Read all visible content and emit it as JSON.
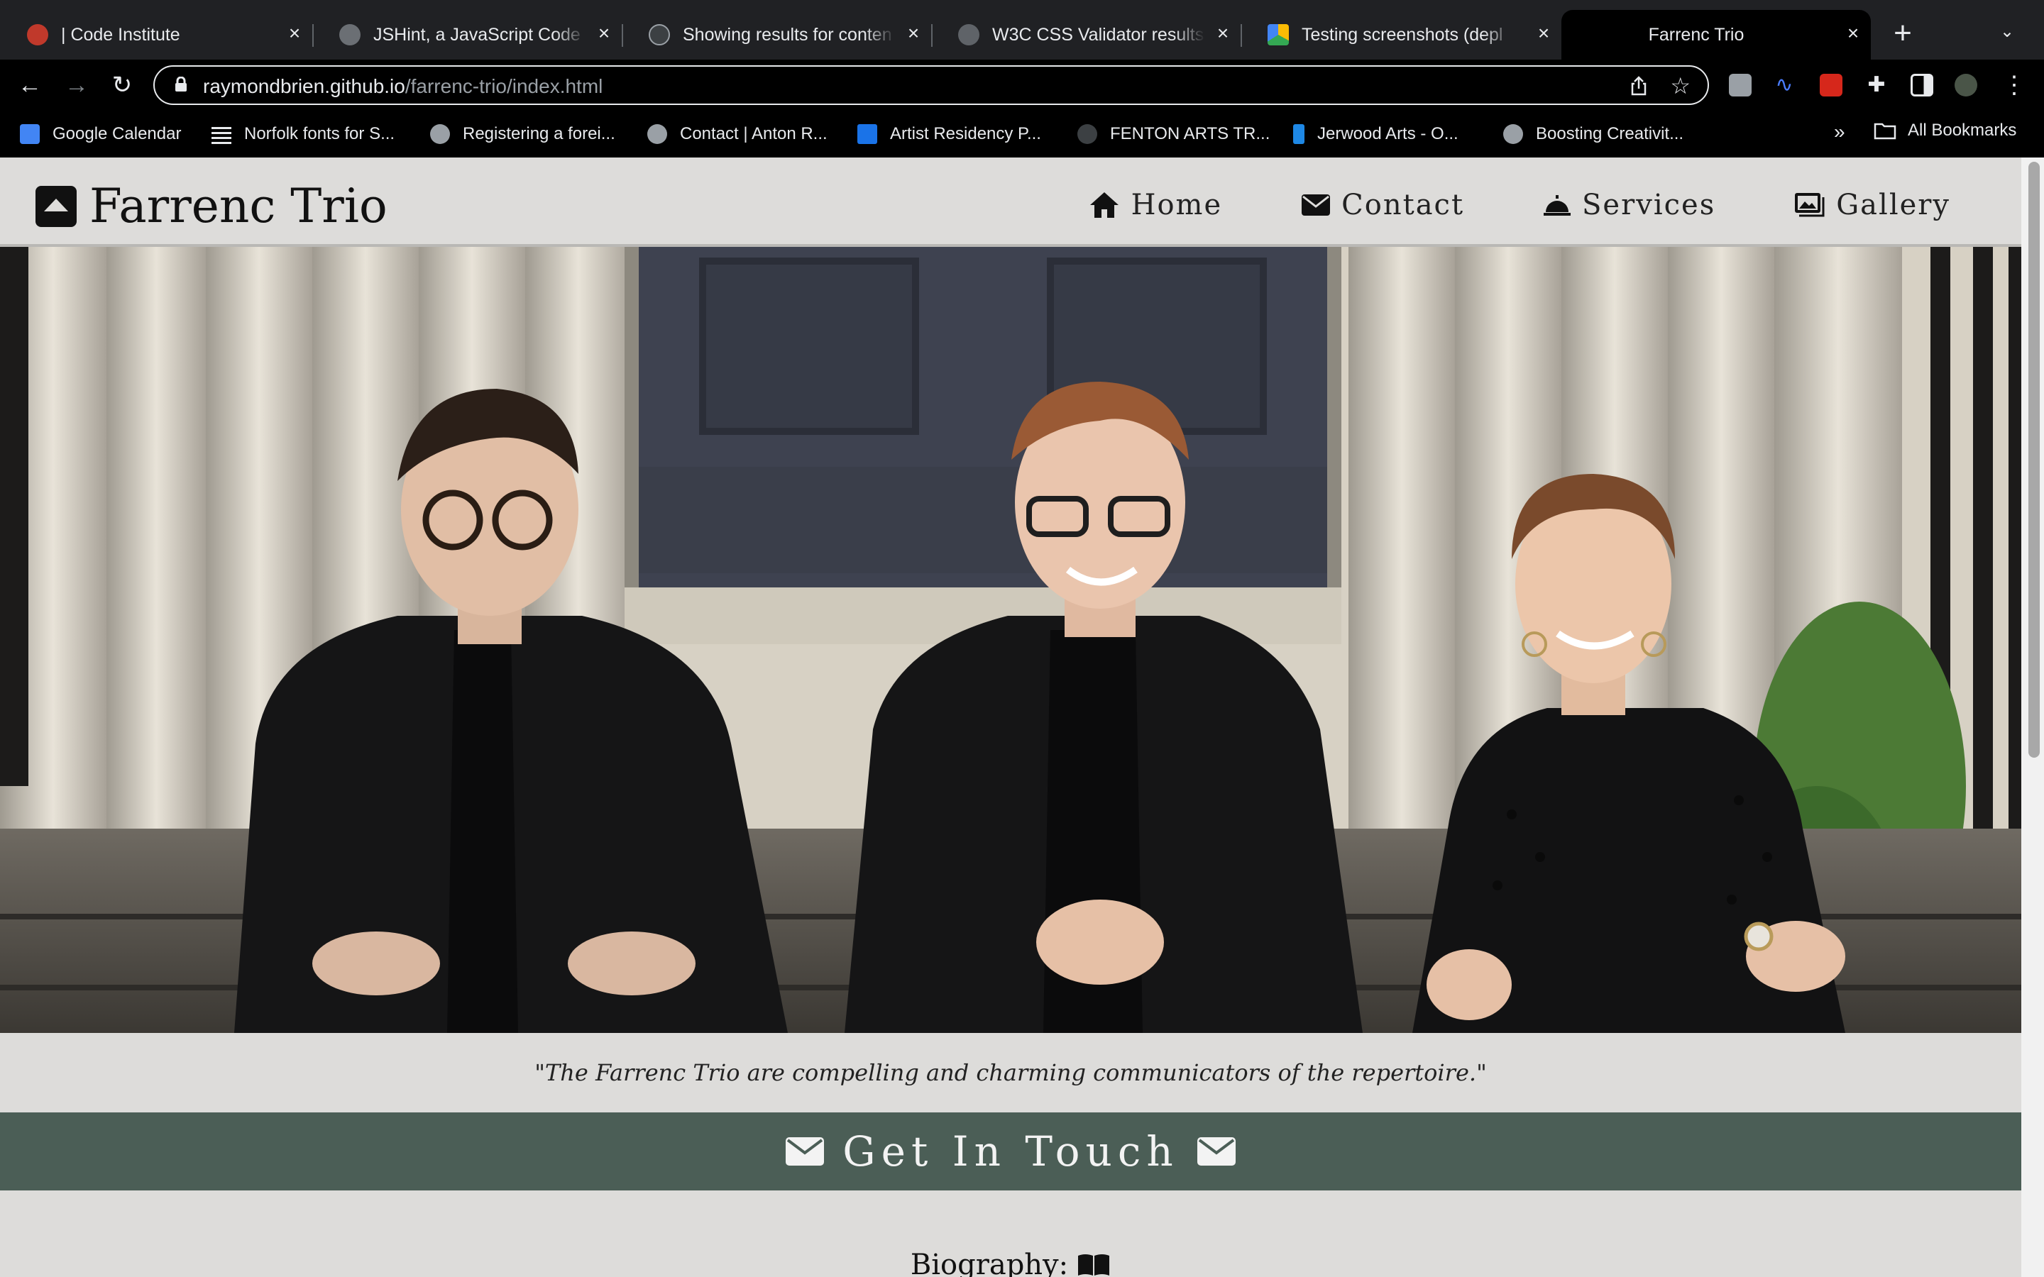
{
  "browser": {
    "tabs": [
      {
        "title": "| Code Institute",
        "active": false
      },
      {
        "title": "JSHint, a JavaScript Code",
        "active": false
      },
      {
        "title": "Showing results for conten",
        "active": false
      },
      {
        "title": "W3C CSS Validator results",
        "active": false
      },
      {
        "title": "Testing screenshots (depl",
        "active": false
      },
      {
        "title": "Farrenc Trio",
        "active": true
      }
    ],
    "url_host": "raymondbrien.github.io",
    "url_path": "/farrenc-trio/index.html",
    "bookmarks": [
      {
        "label": "Google Calendar"
      },
      {
        "label": "Norfolk fonts for S..."
      },
      {
        "label": "Registering a forei..."
      },
      {
        "label": "Contact | Anton R..."
      },
      {
        "label": "Artist Residency P..."
      },
      {
        "label": "FENTON ARTS TR..."
      },
      {
        "label": "Jerwood Arts - O..."
      },
      {
        "label": "Boosting Creativit..."
      }
    ],
    "more_bookmarks": "»",
    "all_bookmarks": "All Bookmarks"
  },
  "site": {
    "brand": "Farrenc Trio",
    "nav": [
      {
        "label": "Home",
        "icon": "home-icon"
      },
      {
        "label": "Contact",
        "icon": "envelope-icon"
      },
      {
        "label": "Services",
        "icon": "bell-icon"
      },
      {
        "label": "Gallery",
        "icon": "images-icon"
      }
    ],
    "quote": "\"The Farrenc Trio are compelling and charming communicators of the repertoire.\"",
    "cta": "Get In Touch",
    "bio_heading": "Biography:"
  },
  "colors": {
    "page_bg": "#dddcda",
    "cta_bg": "#4b5e56",
    "cta_text": "#f3f3f3"
  }
}
